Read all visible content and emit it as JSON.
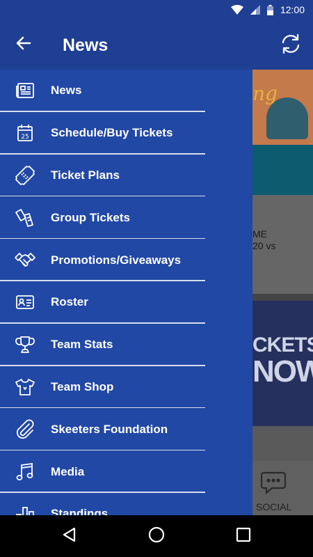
{
  "status_bar": {
    "time": "12:00"
  },
  "app_bar": {
    "title": "News"
  },
  "drawer": {
    "items": [
      {
        "label": "News",
        "icon": "newspaper-icon"
      },
      {
        "label": "Schedule/Buy Tickets",
        "icon": "calendar-icon",
        "calendar_day": "25"
      },
      {
        "label": "Ticket Plans",
        "icon": "ticket-icon"
      },
      {
        "label": "Group Tickets",
        "icon": "tickets-icon"
      },
      {
        "label": "Promotions/Giveaways",
        "icon": "handshake-icon"
      },
      {
        "label": "Roster",
        "icon": "id-card-icon"
      },
      {
        "label": "Team Stats",
        "icon": "trophy-icon"
      },
      {
        "label": "Team Shop",
        "icon": "shirt-icon"
      },
      {
        "label": "Skeeters Foundation",
        "icon": "paperclip-icon"
      },
      {
        "label": "Media",
        "icon": "music-note-icon"
      },
      {
        "label": "Standings",
        "icon": "bar-chart-icon"
      }
    ]
  },
  "background": {
    "card_line1": "ME",
    "card_line2": "20 vs",
    "tickets_line1": "CKETS",
    "tickets_line2": "NOW",
    "social_label": "SOCIAL"
  },
  "colors": {
    "primary": "#2148a4",
    "app_bar": "#1f3f93",
    "divider": "#d8def0"
  }
}
